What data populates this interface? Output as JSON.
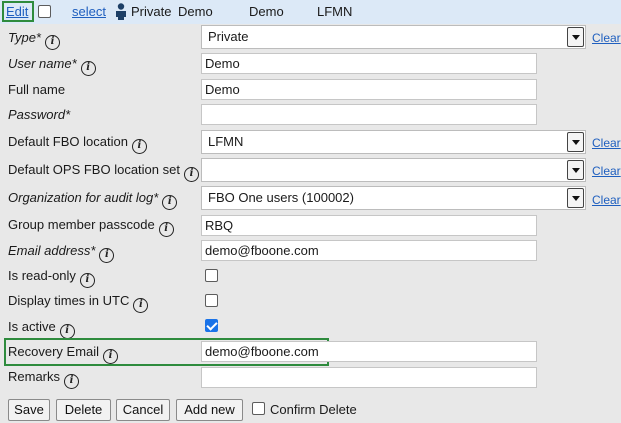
{
  "toolbar": {
    "edit_label": "Edit",
    "select_label": "select",
    "record_type": "Private",
    "record_name": "Demo",
    "record_user": "Demo",
    "record_location": "LFMN"
  },
  "form": {
    "type": {
      "label": "Type*",
      "value": "Private",
      "clear": "Clear"
    },
    "user_name": {
      "label": "User name*",
      "value": "Demo"
    },
    "full_name": {
      "label": "Full name",
      "value": "Demo"
    },
    "password": {
      "label": "Password*",
      "value": ""
    },
    "default_fbo_location": {
      "label": "Default FBO location",
      "value": "LFMN",
      "clear": "Clear"
    },
    "default_ops_fbo_location_set": {
      "label": "Default OPS FBO location set",
      "value": "",
      "clear": "Clear"
    },
    "organization_for_audit_log": {
      "label": "Organization for audit log*",
      "value": "FBO One users (100002)",
      "clear": "Clear"
    },
    "group_member_passcode": {
      "label": "Group member passcode",
      "value": "RBQ"
    },
    "email_address": {
      "label": "Email address*",
      "value": "demo@fboone.com"
    },
    "is_read_only": {
      "label": "Is read-only",
      "checked": false
    },
    "display_times_in_utc": {
      "label": "Display times in UTC",
      "checked": false
    },
    "is_active": {
      "label": "Is active",
      "checked": true
    },
    "recovery_email": {
      "label": "Recovery Email",
      "value": "demo@fboone.com"
    },
    "remarks": {
      "label": "Remarks",
      "value": ""
    }
  },
  "buttons": {
    "save": "Save",
    "delete": "Delete",
    "cancel": "Cancel",
    "add_new": "Add new",
    "confirm_delete": "Confirm Delete"
  },
  "icons": {
    "info": "info-icon",
    "user": "user-icon",
    "dropdown": "chevron-down-icon"
  },
  "colors": {
    "toolbar_bg": "#dce9f7",
    "link": "#1f5fbf",
    "highlight": "#2e8b3d",
    "checkbox_checked": "#1a73e8"
  }
}
